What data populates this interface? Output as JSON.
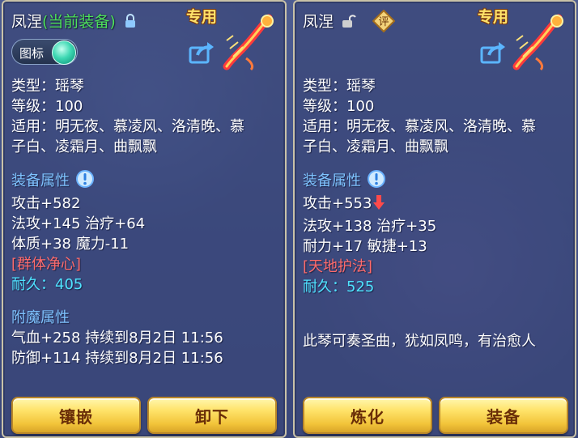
{
  "left_panel": {
    "name": "凤涅",
    "status": "(当前装备)",
    "tag": "专用",
    "toggle_label": "图标",
    "info": {
      "type_line": "类型：瑶琴",
      "level_line": "等级：100",
      "usable_line1": "适用：明无夜、慕凌风、洛清晚、慕",
      "usable_line2": "子白、凌霜月、曲飘飘"
    },
    "attributes": {
      "title": "装备属性",
      "lines": [
        "攻击+582",
        "法攻+145 治疗+64",
        "体质+38 魔力-11"
      ],
      "skill": "[群体净心]",
      "durability_label": "耐久：",
      "durability_value": "405"
    },
    "enchant": {
      "title": "附魔属性",
      "lines": [
        "气血+258 持续到8月2日 11:56",
        "防御+114 持续到8月2日 11:56"
      ]
    },
    "buttons": [
      "镶嵌",
      "卸下"
    ]
  },
  "right_panel": {
    "name": "凤涅",
    "badge": "评",
    "tag": "专用",
    "info": {
      "type_line": "类型：瑶琴",
      "level_line": "等级：100",
      "usable_line1": "适用：明无夜、慕凌风、洛清晚、慕",
      "usable_line2": "子白、凌霜月、曲飘飘"
    },
    "attributes": {
      "title": "装备属性",
      "lines": [
        "攻击+553",
        "法攻+138 治疗+35",
        "耐力+17 敏捷+13"
      ],
      "skill": "[天地护法]",
      "durability_label": "耐久：",
      "durability_value": "525"
    },
    "description": "此琴可奏圣曲，犹如凤鸣，有治愈人",
    "buttons": [
      "炼化",
      "装备"
    ]
  },
  "colors": {
    "section_title": "#7fc3ff",
    "current_equip": "#4de05a",
    "skill": "#ff6b6b",
    "durability": "#4fe3ff",
    "button_text": "#6a2e08",
    "tag": "#ffe36a"
  },
  "icons": [
    "lock-icon",
    "unlock-icon",
    "info-icon",
    "share-icon",
    "down-arrow-icon",
    "zither-item-icon",
    "rating-badge-icon"
  ]
}
